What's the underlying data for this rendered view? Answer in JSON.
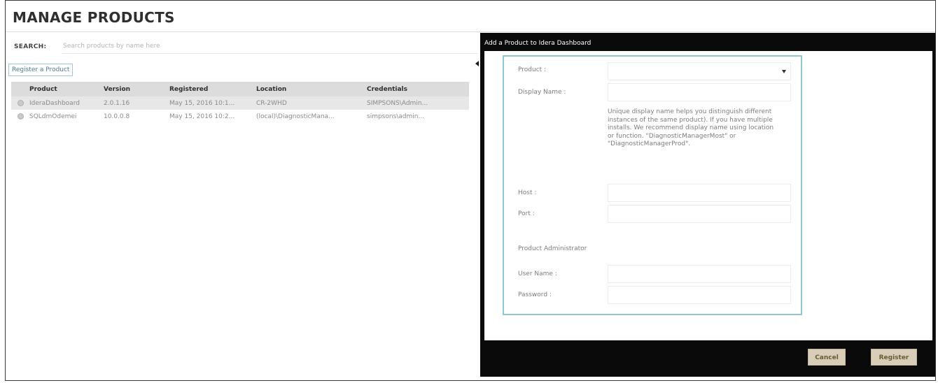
{
  "page": {
    "title": "MANAGE PRODUCTS",
    "search_label": "SEARCH:",
    "search_placeholder": "Search products by name here",
    "register_button_label": "Register a Product"
  },
  "table": {
    "columns": [
      "Product",
      "Version",
      "Registered",
      "Location",
      "Credentials"
    ],
    "rows": [
      {
        "product": "IderaDashboard",
        "version": "2.0.1.16",
        "registered": "May 15, 2016 10:1...",
        "location": "CR-2WHD",
        "credentials": "SIMPSONS\\Admin...",
        "selected": true
      },
      {
        "product": "SQLdmOdemei",
        "version": "10.0.0.8",
        "registered": "May 15, 2016 10:2...",
        "location": "(local)\\DiagnosticMana...",
        "credentials": "simpsons\\admin...",
        "selected": false
      }
    ]
  },
  "modal": {
    "title": "Add a Product to Idera Dashboard",
    "product_label": "Product :",
    "product_value": "",
    "display_name_label": "Display Name :",
    "display_name_value": "",
    "help_text": "Unique display name helps you distinguish different instances of the same product). If you have multiple installs. We recommend display name using location or function. \"DiagnosticManagerMost\" or \"DiagnosticManagerProd\".",
    "host_label": "Host :",
    "port_label": "Port :",
    "admin_section_label": "Product Administrator",
    "username_label": "User Name :",
    "password_label": "Password :",
    "cancel_label": "Cancel",
    "register_label": "Register"
  },
  "colors": {
    "modal_background": "#0a0a0a",
    "panel_border": "#8fc6d2",
    "button_background": "#d7cdb8"
  }
}
